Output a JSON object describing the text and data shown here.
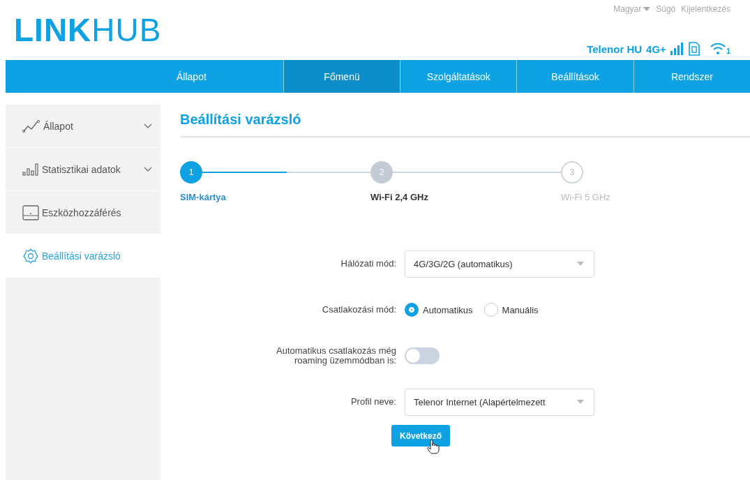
{
  "top_links": [
    {
      "kind": "dropdown",
      "label": "Magyar"
    },
    {
      "kind": "link",
      "label": "Súgó"
    },
    {
      "kind": "link",
      "label": "Kijelentkezés"
    }
  ],
  "logo": "**LINK**HUB",
  "status": {
    "operator": "Telenor HU",
    "network": "4G+",
    "wifi_clients": "1"
  },
  "nav": [
    {
      "label": "Állapot",
      "selected": false
    },
    {
      "label": "Főmenü",
      "selected": true
    },
    {
      "label": "Szolgáltatások",
      "selected": false
    },
    {
      "label": "Beállítások",
      "selected": false
    },
    {
      "label": "Rendszer",
      "selected": false
    }
  ],
  "sidebar": [
    {
      "kind": "chart",
      "label": "Állapot",
      "expandable": true,
      "selected": false
    },
    {
      "kind": "bars",
      "label": "Statisztikai adatok",
      "expandable": true,
      "selected": false
    },
    {
      "kind": "device",
      "label": "Eszközhozzáférés",
      "expandable": false,
      "selected": false
    },
    {
      "kind": "gear",
      "label": "Beállítási varázsló",
      "expandable": false,
      "selected": true
    }
  ],
  "title": "Beállítási varázsló",
  "stepper": {
    "connectors": [
      {
        "level": 0.5
      }
    ],
    "steps": [
      {
        "number": "1",
        "label": "SIM-kártya",
        "kind": "active"
      },
      {
        "number": "2",
        "label": "Wi-Fi 2,4 GHz",
        "kind": "next"
      },
      {
        "number": "3",
        "label": "Wi-Fi 5 GHz",
        "kind": "pending"
      }
    ]
  },
  "form": [
    {
      "kind": "select",
      "label": "Hálózati mód:",
      "value": "4G/3G/2G (automatikus)"
    },
    {
      "kind": "radio",
      "label": "Csatlakozási mód:",
      "options": [
        {
          "label": "Automatikus",
          "selected": true
        },
        {
          "label": "Manuális",
          "selected": false
        }
      ]
    },
    {
      "kind": "toggle",
      "label": "Automatikus csatlakozás még roaming üzemmódban is:",
      "on": false
    },
    {
      "kind": "select",
      "label": "Profil neve:",
      "value": "Telenor Internet (Alapértelmezett"
    }
  ],
  "next_button": "Következő"
}
